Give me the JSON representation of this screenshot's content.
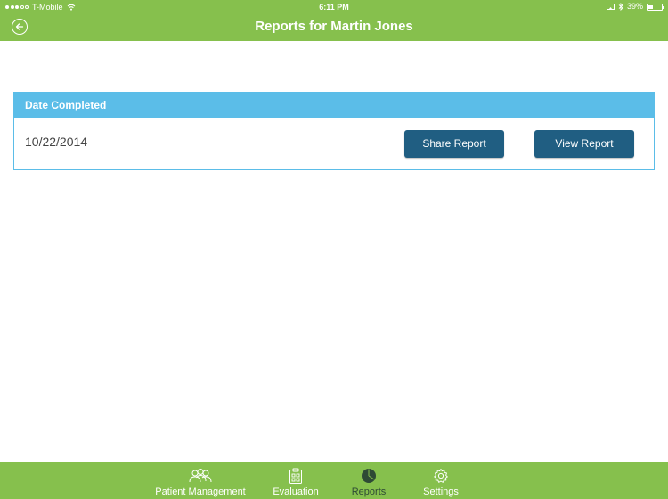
{
  "status_bar": {
    "carrier": "T-Mobile",
    "time": "6:11 PM",
    "battery_percent": "39%",
    "battery_level": 0.39,
    "icons": [
      "signal-dots-icon",
      "wifi-icon",
      "screen-mirror-icon",
      "bluetooth-icon",
      "battery-icon"
    ]
  },
  "nav": {
    "title": "Reports for Martin  Jones",
    "back_icon": "back-arrow-icon"
  },
  "reports_table": {
    "header": "Date Completed",
    "rows": [
      {
        "date": "10/22/2014",
        "share_label": "Share Report",
        "view_label": "View Report"
      }
    ]
  },
  "tabbar": {
    "active": "Reports",
    "tabs": [
      {
        "label": "Patient Management",
        "icon": "people-icon"
      },
      {
        "label": "Evaluation",
        "icon": "clipboard-icon"
      },
      {
        "label": "Reports",
        "icon": "pie-chart-icon"
      },
      {
        "label": "Settings",
        "icon": "gear-icon"
      }
    ]
  },
  "colors": {
    "bar_green": "#86c04d",
    "header_blue": "#5bbde8",
    "button_blue": "#205e82",
    "active_tab": "#2e4a35"
  }
}
